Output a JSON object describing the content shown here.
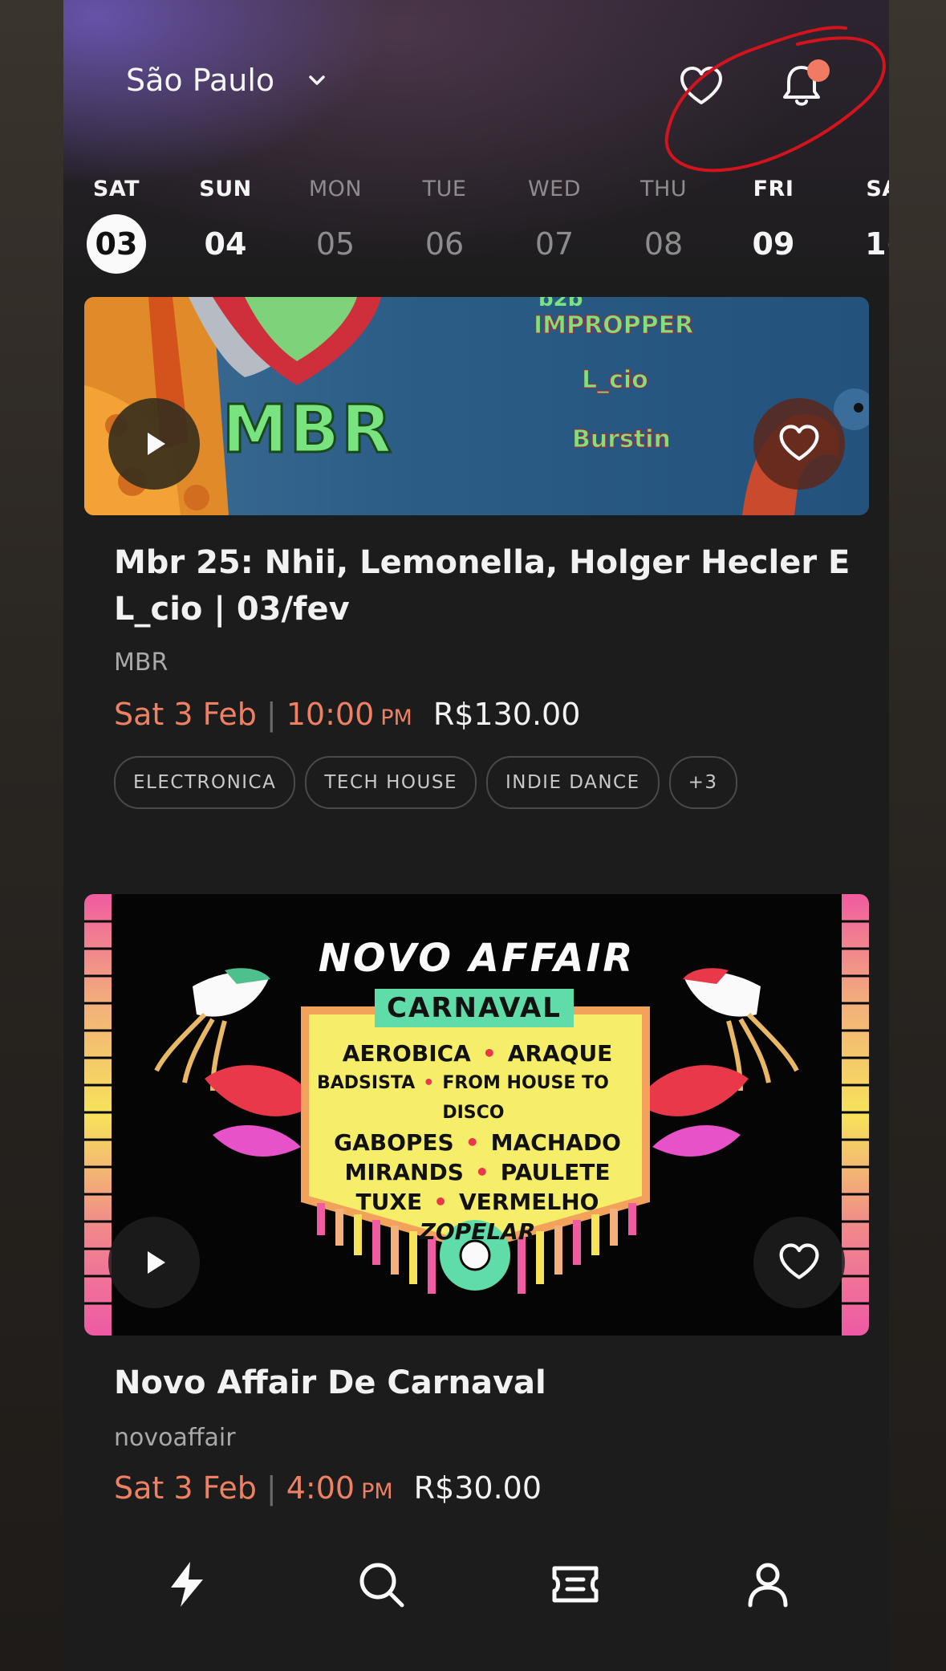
{
  "header": {
    "city": "São Paulo"
  },
  "days": [
    {
      "name": "SAT",
      "date": "03",
      "state": "selected"
    },
    {
      "name": "SUN",
      "date": "04",
      "state": "bright"
    },
    {
      "name": "MON",
      "date": "05",
      "state": "dim"
    },
    {
      "name": "TUE",
      "date": "06",
      "state": "dim"
    },
    {
      "name": "WED",
      "date": "07",
      "state": "dim"
    },
    {
      "name": "THU",
      "date": "08",
      "state": "dim"
    },
    {
      "name": "FRI",
      "date": "09",
      "state": "bright"
    },
    {
      "name": "SA",
      "date": "1(",
      "state": "bright"
    }
  ],
  "events": [
    {
      "title": "Mbr 25: Nhii, Lemonella, Holger Hecler E L_cio  | 03/fev",
      "organizer": "MBR",
      "date": "Sat 3 Feb",
      "time": "10:00",
      "ampm": "PM",
      "price": "R$130.00",
      "tags": [
        "ELECTRONICA",
        "TECH HOUSE",
        "INDIE DANCE",
        "+3"
      ],
      "poster": {
        "brand": "MBR",
        "lines": [
          "b2b",
          "IMPROPPER",
          "L_cio",
          "Burstin"
        ]
      }
    },
    {
      "title": "Novo Affair De Carnaval",
      "organizer": "novoaffair",
      "date": "Sat 3 Feb",
      "time": "4:00",
      "ampm": "PM",
      "price": "R$30.00",
      "poster": {
        "brand": "NOVO AFFAIR",
        "banner": "CARNAVAL",
        "rows": [
          [
            "AEROBICA",
            "ARAQUE"
          ],
          [
            "BADSISTA",
            "FROM HOUSE TO DISCO"
          ],
          [
            "GABOPES",
            "MACHADO"
          ],
          [
            "MIRANDS",
            "PAULETE"
          ],
          [
            "TUXE",
            "VERMELHO"
          ],
          [
            "ZOPELAR",
            ""
          ]
        ]
      }
    }
  ],
  "colors": {
    "accent": "#f08062",
    "background": "#1c1c1c",
    "notification_dot": "#f07a62",
    "annotation": "#d4141c"
  }
}
